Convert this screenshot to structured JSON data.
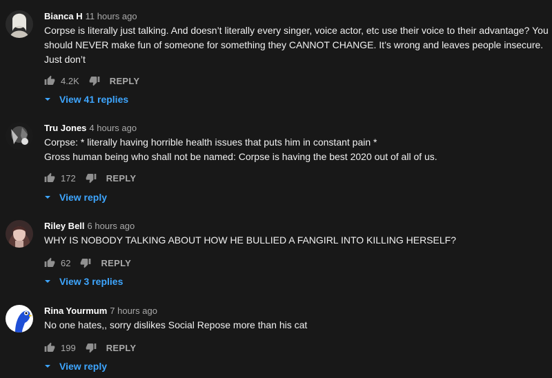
{
  "comments": [
    {
      "author": "Bianca H",
      "time": "11 hours ago",
      "text": "Corpse is literally just talking. And doesn’t literally every singer, voice actor, etc use their voice to their advantage? You should NEVER make fun of someone for something they CANNOT CHANGE. It’s wrong and leaves people insecure. Just don’t",
      "likes": "4.2K",
      "reply_label": "REPLY",
      "replies_label": "View 41 replies",
      "avatar_icon": "avatar-photo"
    },
    {
      "author": "Tru Jones",
      "time": "4 hours ago",
      "text": "Corpse: * literally having horrible health issues that puts him in constant pain *\nGross human being who shall not be named: Corpse is having the best 2020 out of all of us.",
      "likes": "172",
      "reply_label": "REPLY",
      "replies_label": "View reply",
      "avatar_icon": "avatar-photo"
    },
    {
      "author": "Riley Bell",
      "time": "6 hours ago",
      "text": "WHY IS NOBODY TALKING ABOUT HOW HE BULLIED A FANGIRL INTO KILLING HERSELF?",
      "likes": "62",
      "reply_label": "REPLY",
      "replies_label": "View 3 replies",
      "avatar_icon": "avatar-photo"
    },
    {
      "author": "Rina Yourmum",
      "time": "7 hours ago",
      "text": "No one hates,, sorry dislikes Social Repose more than his cat",
      "likes": "199",
      "reply_label": "REPLY",
      "replies_label": "View reply",
      "avatar_icon": "avatar-photo"
    }
  ],
  "colors": {
    "background": "#181818",
    "link_blue": "#3ea6ff",
    "muted": "#aaaaaa"
  }
}
